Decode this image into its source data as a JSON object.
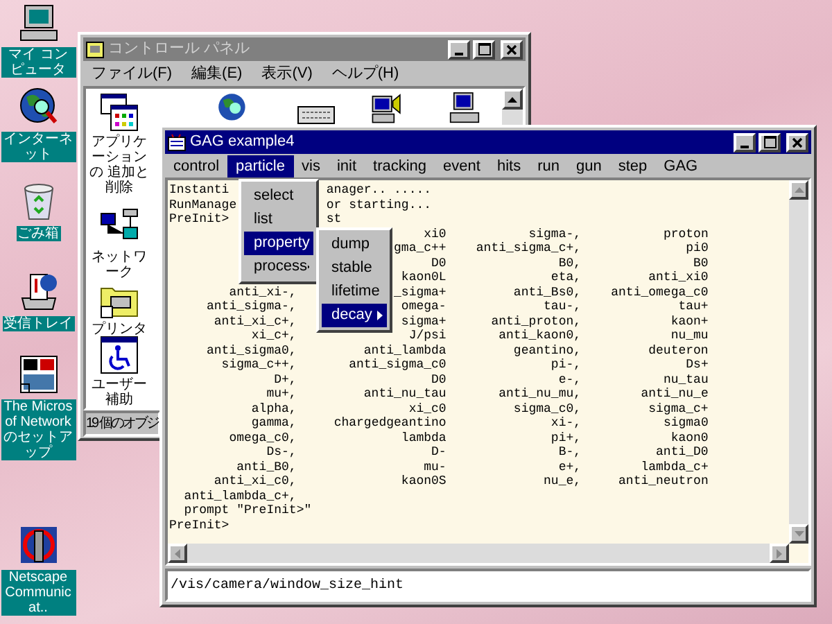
{
  "desktop_icons": [
    {
      "label": "マイ コンピュータ"
    },
    {
      "label": "インターネット"
    },
    {
      "label": "ごみ箱"
    },
    {
      "label": "受信トレイ"
    },
    {
      "label": "The Microsof Network のセットアップ"
    },
    {
      "label": "Netscape Communicat.."
    }
  ],
  "control_panel": {
    "title": "コントロール パネル",
    "menu": [
      "ファイル(F)",
      "編集(E)",
      "表示(V)",
      "ヘルプ(H)"
    ],
    "items": [
      {
        "label": "アプリケーションの 追加と削除"
      },
      {
        "label": "ネットワーク"
      },
      {
        "label": "プリンタ"
      },
      {
        "label": "ユーザー補助"
      }
    ],
    "status": "19 個のオブジ"
  },
  "gag_window": {
    "title": "GAG example4",
    "menubar": [
      {
        "label": "control",
        "selected": false
      },
      {
        "label": "particle",
        "selected": true
      },
      {
        "label": "vis",
        "selected": false
      },
      {
        "label": "init",
        "selected": false
      },
      {
        "label": "tracking",
        "selected": false
      },
      {
        "label": "event",
        "selected": false
      },
      {
        "label": "hits",
        "selected": false
      },
      {
        "label": "run",
        "selected": false
      },
      {
        "label": "gun",
        "selected": false
      },
      {
        "label": "step",
        "selected": false
      },
      {
        "label": "GAG",
        "selected": false
      }
    ],
    "menu": [
      {
        "label": "select",
        "selected": false,
        "has_submenu": false
      },
      {
        "label": "list",
        "selected": false,
        "has_submenu": false
      },
      {
        "label": "property",
        "selected": true,
        "has_submenu": true
      },
      {
        "label": "process",
        "selected": false,
        "has_submenu": true
      }
    ],
    "submenu": [
      {
        "label": "dump",
        "selected": false,
        "has_submenu": false
      },
      {
        "label": "stable",
        "selected": false,
        "has_submenu": false
      },
      {
        "label": "lifetime",
        "selected": false,
        "has_submenu": false
      },
      {
        "label": "decay",
        "selected": true,
        "has_submenu": true
      }
    ],
    "console": [
      {
        "kind": "split",
        "left": "Instanti",
        "right": "anager.. ....."
      },
      {
        "kind": "split",
        "left": "RunManage",
        "right": "or starting..."
      },
      {
        "kind": "split",
        "left": "PreInit>",
        "right": "st"
      },
      {
        "kind": "row",
        "col_2": "xi0",
        "col_3": "sigma-,",
        "col_4": "proton"
      },
      {
        "kind": "row",
        "col_2": "gma_c++",
        "col_3": "anti_sigma_c+,",
        "col_4": "pi0"
      },
      {
        "kind": "row",
        "col_2": "D0",
        "col_3": "B0,",
        "col_4": "B0"
      },
      {
        "kind": "row",
        "col_2": "kaon0L",
        "col_3": "eta,",
        "col_4": "anti_xi0"
      },
      {
        "kind": "row",
        "col_1": "anti_xi-,",
        "col_2": "_sigma+",
        "col_3": "anti_Bs0,",
        "col_4": "anti_omega_c0"
      },
      {
        "kind": "row",
        "col_1": "anti_sigma-,",
        "col_2": "omega-",
        "col_3": "tau-,",
        "col_4": "tau+"
      },
      {
        "kind": "row",
        "col_1": "anti_xi_c+,",
        "col_2": "sigma+",
        "col_3": "anti_proton,",
        "col_4": "kaon+"
      },
      {
        "kind": "row",
        "col_1": "xi_c+,",
        "col_2": "J/psi",
        "col_3": "anti_kaon0,",
        "col_4": "nu_mu"
      },
      {
        "kind": "row",
        "col_1": "anti_sigma0,",
        "col_2": "anti_lambda",
        "col_3": "geantino,",
        "col_4": "deuteron"
      },
      {
        "kind": "row",
        "col_1": "sigma_c++,",
        "col_2": "anti_sigma_c0",
        "col_3": "pi-,",
        "col_4": "Ds+"
      },
      {
        "kind": "row",
        "col_1": "D+,",
        "col_2": "D0",
        "col_3": "e-,",
        "col_4": "nu_tau"
      },
      {
        "kind": "row",
        "col_1": "mu+,",
        "col_2": "anti_nu_tau",
        "col_3": "anti_nu_mu,",
        "col_4": "anti_nu_e"
      },
      {
        "kind": "row",
        "col_1": "alpha,",
        "col_2": "xi_c0",
        "col_3": "sigma_c0,",
        "col_4": "sigma_c+"
      },
      {
        "kind": "row",
        "col_1": "gamma,",
        "col_2": "chargedgeantino",
        "col_3": "xi-,",
        "col_4": "sigma0"
      },
      {
        "kind": "row",
        "col_1": "omega_c0,",
        "col_2": "lambda",
        "col_3": "pi+,",
        "col_4": "kaon0"
      },
      {
        "kind": "row",
        "col_1": "Ds-,",
        "col_2": "D-",
        "col_3": "B-,",
        "col_4": "anti_D0"
      },
      {
        "kind": "row",
        "col_1": "anti_B0,",
        "col_2": "mu-",
        "col_3": "e+,",
        "col_4": "lambda_c+"
      },
      {
        "kind": "row",
        "col_1": "anti_xi_c0,",
        "col_2": "kaon0S",
        "col_3": "nu_e,",
        "col_4": "anti_neutron"
      },
      {
        "kind": "row",
        "col_1": "anti_lambda_c+,"
      },
      {
        "kind": "plain",
        "text": "  prompt \"PreInit>\""
      },
      {
        "kind": "plain",
        "text": "PreInit>"
      }
    ],
    "command": "/vis/camera/window_size_hint"
  }
}
